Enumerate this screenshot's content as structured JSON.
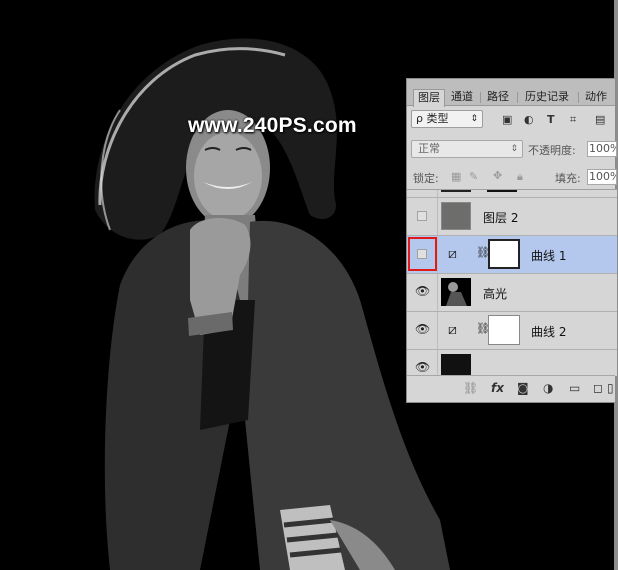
{
  "watermark": "www.240PS.com",
  "panel": {
    "tabs": [
      {
        "label": "图层",
        "active": true
      },
      {
        "label": "通道",
        "active": false
      },
      {
        "label": "路径",
        "active": false
      },
      {
        "label": "历史记录",
        "active": false
      },
      {
        "label": "动作",
        "active": false
      }
    ],
    "filter_kind": "ρ 类型",
    "filter_icons": [
      "image-filter-icon",
      "adjustment-filter-icon",
      "type-filter-icon",
      "shape-filter-icon",
      "smart-object-filter-icon"
    ],
    "blend_mode": "正常",
    "opacity_label": "不透明度:",
    "opacity_value": "100%",
    "lock_label": "锁定:",
    "fill_label": "填充:",
    "fill_value": "100%",
    "layers": [
      {
        "name": "",
        "visible": false,
        "kind": "partial"
      },
      {
        "name": "图层 2",
        "visible": false,
        "kind": "gray-fill",
        "selected": false
      },
      {
        "name": "曲线 1",
        "visible": false,
        "kind": "curves",
        "selected": true,
        "highlighted": true
      },
      {
        "name": "高光",
        "visible": true,
        "kind": "photo",
        "selected": false
      },
      {
        "name": "曲线 2",
        "visible": true,
        "kind": "curves",
        "selected": false
      },
      {
        "name": "",
        "visible": true,
        "kind": "partial"
      }
    ],
    "bottom_icons": [
      "link-icon",
      "fx-icon",
      "mask-icon",
      "adjustment-icon",
      "group-icon",
      "new-layer-icon",
      "delete-icon"
    ]
  },
  "colors": {
    "panel_bg": "#d6d6d6",
    "selected_row": "#b4c8ee",
    "highlight_red": "#e01a1a",
    "gray_fill_layer": "#6d6d6b"
  }
}
